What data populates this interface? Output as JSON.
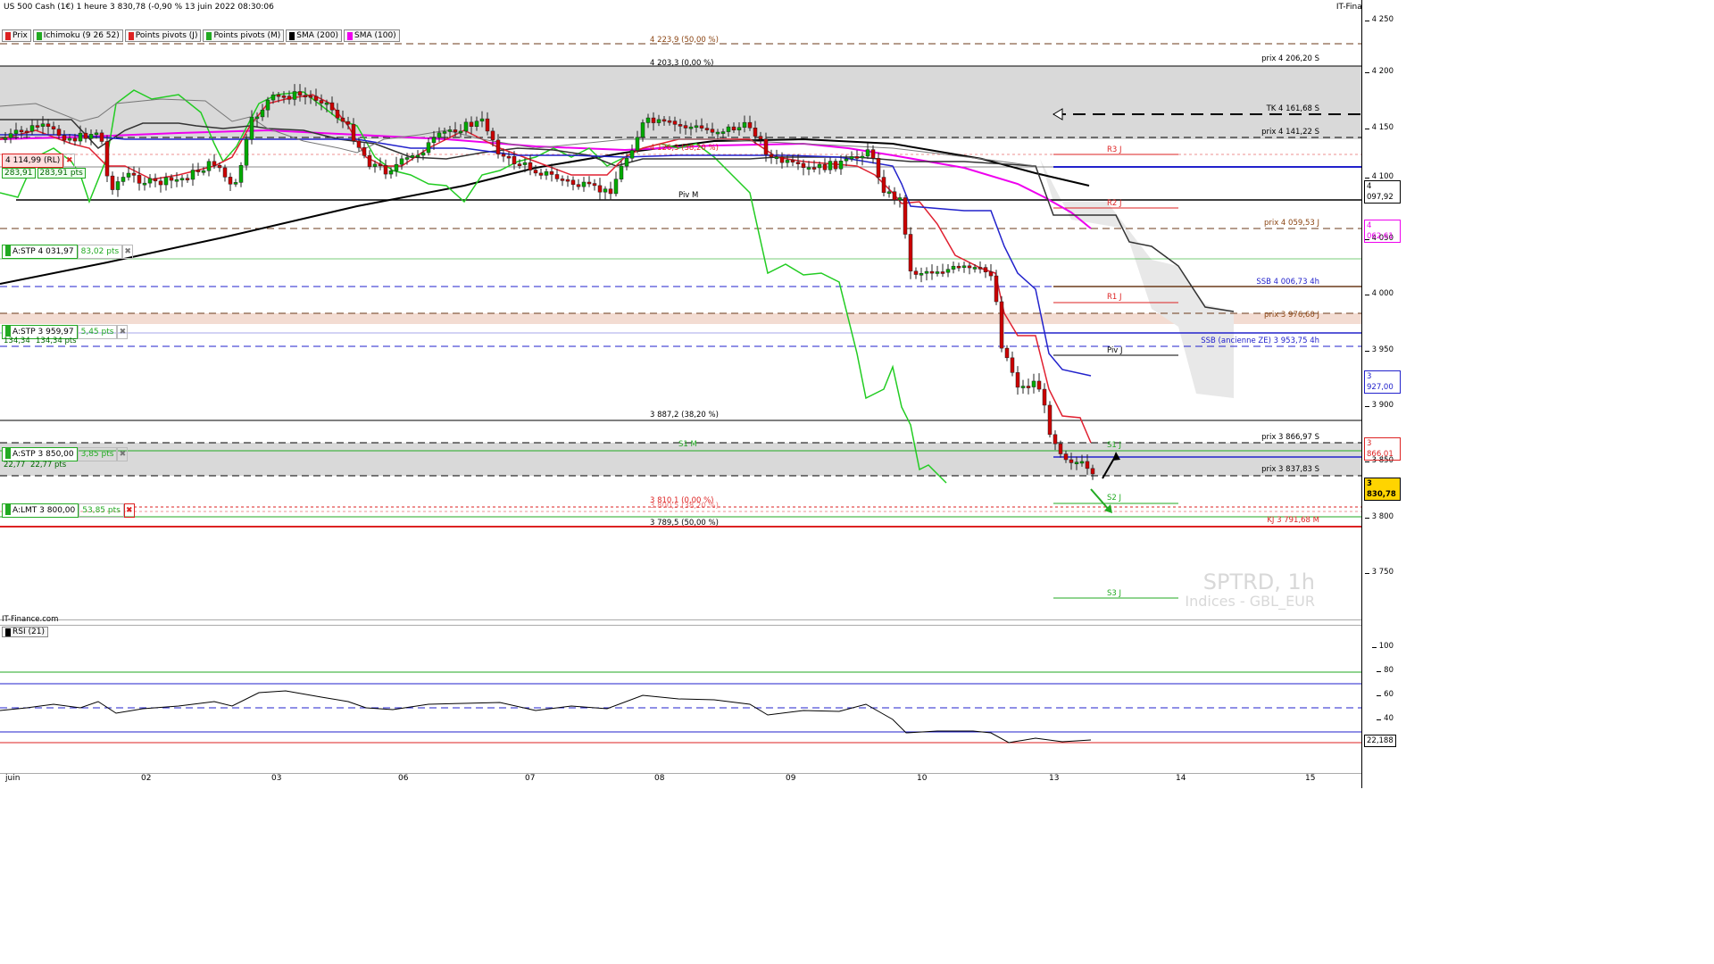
{
  "header": {
    "title": "US 500 Cash (1€) 1 heure 3 830,78 (-0,90 % 13 juin 2022 08:30:06",
    "brand": "IT-Finance.com"
  },
  "legend": [
    {
      "label": "Prix",
      "color": "#d22"
    },
    {
      "label": "Ichimoku (9 26 52)",
      "color": "#2a2"
    },
    {
      "label": "Points pivots (J)",
      "color": "#d22"
    },
    {
      "label": "Points pivots (M)",
      "color": "#2a2"
    },
    {
      "label": "SMA (200)",
      "color": "#000"
    },
    {
      "label": "SMA (100)",
      "color": "#e0e"
    }
  ],
  "price_axis": {
    "ticks": [
      "4 250",
      "4 200",
      "4 150",
      "4 100",
      "4 050",
      "4 000",
      "3 950",
      "3 900",
      "3 850",
      "3 800",
      "3 750"
    ],
    "tags": [
      {
        "text": "4 097,92",
        "color": "#000",
        "bg": "#fff"
      },
      {
        "text": "4 062,61",
        "color": "#e0e",
        "bg": "#fff"
      },
      {
        "text": "3 927,00",
        "color": "#22c",
        "bg": "#fff"
      },
      {
        "text": "3 866,01",
        "color": "#d22",
        "bg": "#fff"
      },
      {
        "text": "3 830,78",
        "color": "#000",
        "bg": "#ffd400"
      }
    ]
  },
  "rsi_axis": {
    "ticks": [
      "100",
      "80",
      "60",
      "40"
    ],
    "current": "22,188",
    "label": "RSI (21)"
  },
  "levels": {
    "fib_50_top": "4 223,9 (50,00 %)",
    "fib_0_top": "4 203,3 (0,00 %)",
    "prix_4206": "prix 4 206,20 S",
    "tk": "TK 4 161,68 S",
    "prix_4141": "prix 4 141,22 S",
    "r3": "R3 J",
    "fib_382_top": "4 126,3 (38,20 %)",
    "piv_m": "Piv M",
    "r2": "R2 J",
    "prix_4059": "prix 4 059,53 J",
    "ssb": "SSB 4 006,73 4h",
    "r1": "R1 J",
    "prix_3976": "prix 3 976,60 J",
    "ssb_old": "SSB (ancienne ZE) 3 953,75 4h",
    "piv_j": "Piv J",
    "fib_382_mid": "3 887,2 (38,20 %)",
    "prix_3866": "prix 3 866,97 S",
    "s1m": "S1 M",
    "s1j": "S1 J",
    "prix_3837": "prix 3 837,83 S",
    "fib_0_mid": "3 810,1 (0,00 %)",
    "fib_50_mid_hidden": "3 800,5 (38,20 %)",
    "s2j": "S2 J",
    "kj": "KJ 3 791,68 M",
    "fib_50_low": "3 789,5 (50,00 %)",
    "s3j": "S3 J"
  },
  "orders": [
    {
      "label": "A:STP 4 031,97",
      "pts": "83,02 pts"
    },
    {
      "label": "A:STP 3 959,97",
      "pts": "5,45 pts"
    },
    {
      "label": "A:STP 3 850,00",
      "pts": "3,85 pts"
    },
    {
      "label": "A:LMT 3 800,00",
      "pts": "53,85 pts"
    }
  ],
  "rl_box": {
    "label": "4 114,99 (RL)",
    "v1": "283,91",
    "v2": "283,91 pts"
  },
  "small_vals": {
    "a": "134,34",
    "b": "134,34 pts",
    "c": "22,77",
    "d": "22,77 pts"
  },
  "watermark": {
    "symbol": "SPTRD, 1h",
    "sub": "Indices - GBL_EUR"
  },
  "footer_brand": "IT-Finance.com",
  "xaxis": [
    "juin",
    "02",
    "03",
    "06",
    "07",
    "08",
    "09",
    "10",
    "13",
    "14",
    "15"
  ]
}
